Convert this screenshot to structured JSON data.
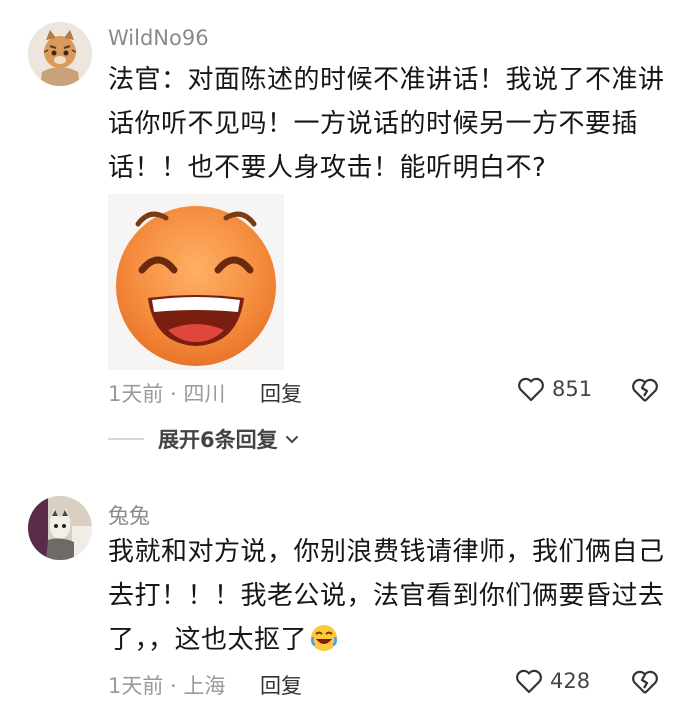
{
  "comments": [
    {
      "username": "WildNo96",
      "text": "法官：对面陈述的时候不准讲话！我说了不准讲话你听不见吗！一方说话的时候另一方不要插话！！也不要人身攻击！能听明白不?",
      "time_location": "1天前 · 四川",
      "reply_label": "回复",
      "likes": "851",
      "expand_replies": "展开6条回复"
    },
    {
      "username": "兔兔",
      "text": "我就和对方说，你别浪费钱请律师，我们俩自己去打！！！我老公说，法官看到你们俩要昏过去了，，这也太抠了",
      "time_location": "1天前 · 上海",
      "reply_label": "回复",
      "likes": "428"
    }
  ],
  "colors": {
    "sticker_face": "#f48a3c",
    "username": "#8a8a8a",
    "meta": "#9a9a9a"
  }
}
